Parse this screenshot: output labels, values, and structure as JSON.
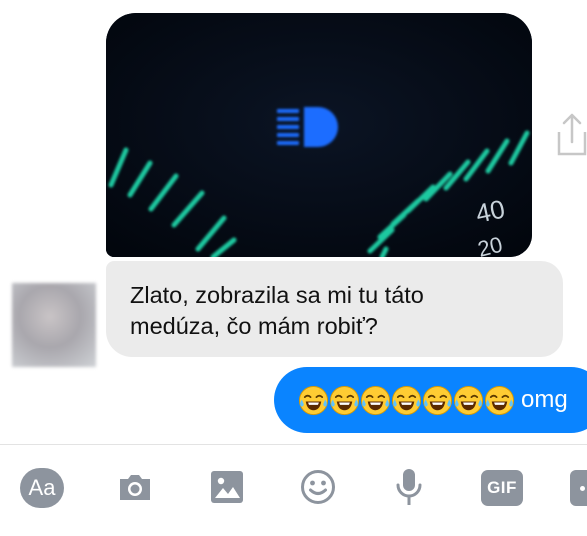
{
  "conversation": {
    "photo": {
      "subject": "dashboard-headlight-indicator",
      "gauge_label": "40",
      "gauge_label_partial": "20"
    },
    "incoming": {
      "lines": [
        "Zlato, zobrazila sa mi tu táto",
        "medúza, čo mám robiť?"
      ]
    },
    "outgoing": {
      "emoji_name": "face-with-tears-of-joy",
      "emoji_count": 7,
      "text": "omg"
    }
  },
  "composer": {
    "text_button_label": "Aa",
    "gif_button_label": "GIF",
    "icons": [
      "camera-icon",
      "gallery-icon",
      "emoji-icon",
      "microphone-icon",
      "more-icon"
    ]
  },
  "colors": {
    "outgoing_bubble": "#0a84ff",
    "incoming_bubble": "#ebebeb",
    "toolbar_icon": "#8d949e",
    "gauge_tick": "#1fc9a0",
    "indicator": "#1f6dff"
  }
}
